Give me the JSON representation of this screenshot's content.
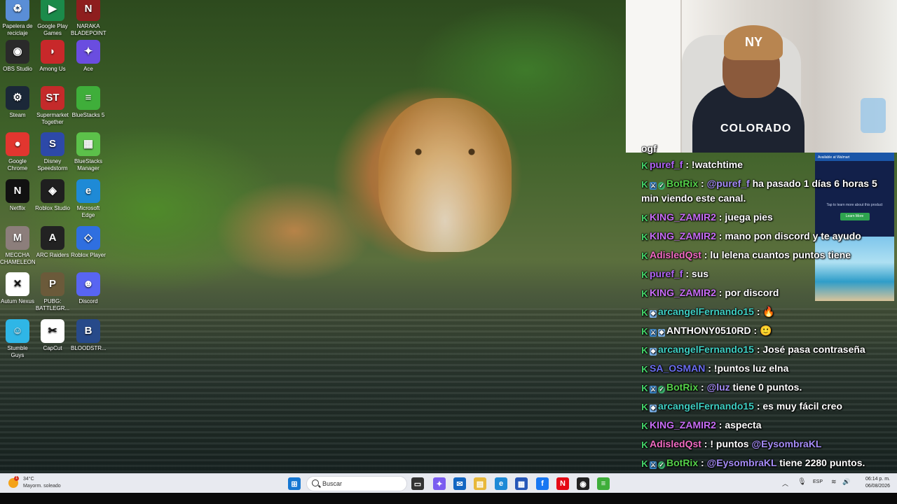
{
  "desktop": {
    "icons": [
      {
        "label": "Papelera de reciclaje",
        "icon": "recycle-bin-icon",
        "color": "#5a8ed6",
        "glyph": "♻"
      },
      {
        "label": "Google Play Games",
        "icon": "google-play-games-icon",
        "color": "#1b8a4a",
        "glyph": "▶"
      },
      {
        "label": "NARAKA BLADEPOINT",
        "icon": "naraka-icon",
        "color": "#8e1e1e",
        "glyph": "N"
      },
      {
        "label": "OBS Studio",
        "icon": "obs-icon",
        "color": "#2a2a2a",
        "glyph": "◉"
      },
      {
        "label": "Among Us",
        "icon": "among-us-icon",
        "color": "#c8282a",
        "glyph": "◗"
      },
      {
        "label": "Ace",
        "icon": "ace-icon",
        "color": "#6a4de0",
        "glyph": "✦"
      },
      {
        "label": "Steam",
        "icon": "steam-icon",
        "color": "#1b2838",
        "glyph": "⚙"
      },
      {
        "label": "Supermarket Together",
        "icon": "supermarket-together-icon",
        "color": "#c42a2a",
        "glyph": "ST"
      },
      {
        "label": "BlueStacks 5",
        "icon": "bluestacks-icon",
        "color": "#3fae3a",
        "glyph": "≡"
      },
      {
        "label": "Google Chrome",
        "icon": "chrome-icon",
        "color": "#e2362f",
        "glyph": "●"
      },
      {
        "label": "Disney Speedstorm",
        "icon": "disney-speedstorm-icon",
        "color": "#2d49a8",
        "glyph": "S"
      },
      {
        "label": "BlueStacks Manager",
        "icon": "bluestacks-manager-icon",
        "color": "#5cc14a",
        "glyph": "▦"
      },
      {
        "label": "Netflix",
        "icon": "netflix-icon",
        "color": "#111111",
        "glyph": "N"
      },
      {
        "label": "Roblox Studio",
        "icon": "roblox-studio-icon",
        "color": "#1f1f1f",
        "glyph": "◈"
      },
      {
        "label": "Microsoft Edge",
        "icon": "edge-icon",
        "color": "#1e8ad6",
        "glyph": "e"
      },
      {
        "label": "MECCHA CHAMELEON",
        "icon": "meccha-chameleon-icon",
        "color": "#8c7e7b",
        "glyph": "M"
      },
      {
        "label": "ARC Raiders",
        "icon": "arc-raiders-icon",
        "color": "#222222",
        "glyph": "A"
      },
      {
        "label": "Roblox Player",
        "icon": "roblox-player-icon",
        "color": "#2f6fe0",
        "glyph": "◇"
      },
      {
        "label": "Autum Nexus",
        "icon": "autum-nexus-icon",
        "color": "#ffffff",
        "glyph": "✕"
      },
      {
        "label": "PUBG: BATTLEGR...",
        "icon": "pubg-icon",
        "color": "#6b5a3a",
        "glyph": "P"
      },
      {
        "label": "Discord",
        "icon": "discord-icon",
        "color": "#5865f2",
        "glyph": "☻"
      },
      {
        "label": "Stumble Guys",
        "icon": "stumble-guys-icon",
        "color": "#2fb6e6",
        "glyph": "☺"
      },
      {
        "label": "CapCut",
        "icon": "capcut-icon",
        "color": "#ffffff",
        "glyph": "✂"
      },
      {
        "label": "BLOODSTR...",
        "icon": "bloodstrike-icon",
        "color": "#274a8a",
        "glyph": "B"
      }
    ]
  },
  "webcam": {
    "cap_logo": "NY",
    "shirt_text": "COLORADO"
  },
  "ad": {
    "top_text": "Available at Walmart",
    "body_text": "Tap to learn more about this product",
    "button_label": "Learn More"
  },
  "chat": {
    "header_fragment": "ogf",
    "messages": [
      {
        "badges": [
          "k"
        ],
        "user": "puref_f",
        "user_color": "#b064f5",
        "text": "!watchtime",
        "wrap": false
      },
      {
        "badges": [
          "k",
          "mod",
          "ver"
        ],
        "user": "BotRix",
        "user_color": "#55d24a",
        "mention": "@puref_f",
        "text": " ha pasado 1 días 6 horas 5 min viendo este canal.",
        "wrap": true
      },
      {
        "badges": [
          "k"
        ],
        "user": "KING_ZAMIR2",
        "user_color": "#c76df5",
        "text": "juega pies",
        "wrap": false
      },
      {
        "badges": [
          "k"
        ],
        "user": "KING_ZAMIR2",
        "user_color": "#c76df5",
        "text": "mano pon discord y te ayudo",
        "wrap": false
      },
      {
        "badges": [
          "k"
        ],
        "user": "AdisledQst",
        "user_color": "#f26cc4",
        "text": "lu lelena cuantos puntos tiene",
        "wrap": false
      },
      {
        "badges": [
          "k"
        ],
        "user": "puref_f",
        "user_color": "#b064f5",
        "text": "sus",
        "wrap": false
      },
      {
        "badges": [
          "k"
        ],
        "user": "KING_ZAMIR2",
        "user_color": "#c76df5",
        "text": "por discord",
        "wrap": false
      },
      {
        "badges": [
          "k",
          "sub"
        ],
        "user": "arcangelFernando15",
        "user_color": "#3fd0c4",
        "text": "🔥",
        "wrap": false
      },
      {
        "badges": [
          "k",
          "mod",
          "sub"
        ],
        "user": "ANTHONY0510RD",
        "user_color": "#ffffff",
        "text": "🙂",
        "wrap": false
      },
      {
        "badges": [
          "k",
          "sub"
        ],
        "user": "arcangelFernando15",
        "user_color": "#3fd0c4",
        "text": "José pasa contraseña",
        "wrap": false
      },
      {
        "badges": [
          "k"
        ],
        "user": "SA_OSMAN",
        "user_color": "#6a6df0",
        "text": "!puntos luz elna",
        "wrap": false
      },
      {
        "badges": [
          "k",
          "mod",
          "ver"
        ],
        "user": "BotRix",
        "user_color": "#55d24a",
        "mention": "@luz",
        "text": " tiene 0 puntos.",
        "wrap": false
      },
      {
        "badges": [
          "k",
          "sub"
        ],
        "user": "arcangelFernando15",
        "user_color": "#3fd0c4",
        "text": "es muy fácil creo",
        "wrap": false
      },
      {
        "badges": [
          "k"
        ],
        "user": "KING_ZAMIR2",
        "user_color": "#c76df5",
        "text": "aspecta",
        "wrap": false
      },
      {
        "badges": [
          "k"
        ],
        "user": "AdisledQst",
        "user_color": "#f26cc4",
        "text": "! puntos ",
        "mention_after": "@EysombraKL",
        "wrap": false
      },
      {
        "badges": [
          "k",
          "mod",
          "ver"
        ],
        "user": "BotRix",
        "user_color": "#55d24a",
        "mention": "@EysombraKL",
        "text": " tiene 2280 puntos.",
        "wrap": false
      }
    ]
  },
  "taskbar": {
    "weather_temp": "34°C",
    "weather_desc": "Mayorm. soleado",
    "weather_alert": "1",
    "search_placeholder": "Buscar",
    "language": "ESP",
    "time": "06:14 p. m.",
    "date": "06/08/2026",
    "apps": [
      {
        "name": "start-icon",
        "color": "#1677d2",
        "glyph": "⊞"
      },
      {
        "name": "task-view-icon",
        "color": "#333333",
        "glyph": "▭"
      },
      {
        "name": "copilot-icon",
        "color": "#7a5cf0",
        "glyph": "✦"
      },
      {
        "name": "outlook-icon",
        "color": "#1366c2",
        "glyph": "✉"
      },
      {
        "name": "file-explorer-icon",
        "color": "#e8b83a",
        "glyph": "▤"
      },
      {
        "name": "edge-taskbar-icon",
        "color": "#1e8ad6",
        "glyph": "e"
      },
      {
        "name": "store-icon",
        "color": "#2657b8",
        "glyph": "▦"
      },
      {
        "name": "facebook-icon",
        "color": "#1877f2",
        "glyph": "f"
      },
      {
        "name": "netflix-taskbar-icon",
        "color": "#e50914",
        "glyph": "N"
      },
      {
        "name": "obs-taskbar-icon",
        "color": "#222222",
        "glyph": "◉"
      },
      {
        "name": "bluestacks-taskbar-icon",
        "color": "#3fae3a",
        "glyph": "≡"
      }
    ]
  }
}
